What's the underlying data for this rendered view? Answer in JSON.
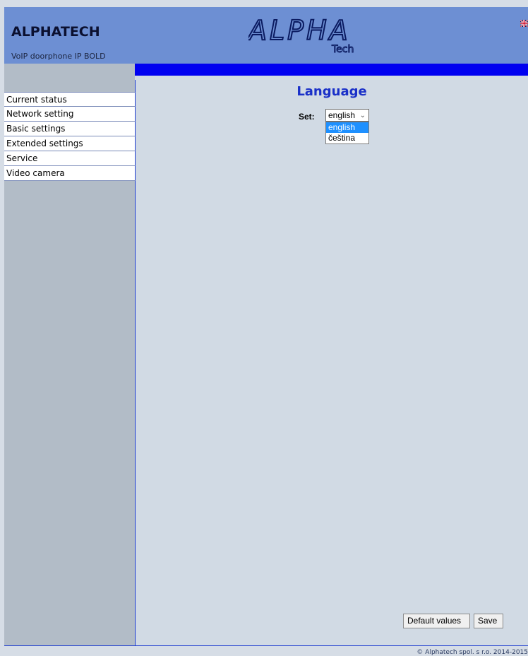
{
  "header": {
    "title": "ALPHATECH",
    "subtitle": "VoIP doorphone IP BOLD",
    "logo_text_main": "ALPHA",
    "logo_text_sub": "Tech",
    "flag_icon": "uk-flag-icon"
  },
  "sidebar": {
    "items": [
      {
        "label": "Current status"
      },
      {
        "label": "Network setting"
      },
      {
        "label": "Basic settings"
      },
      {
        "label": "Extended settings"
      },
      {
        "label": "Service"
      },
      {
        "label": "Video camera"
      }
    ]
  },
  "main": {
    "heading": "Language",
    "set_label": "Set:",
    "language_select": {
      "value": "english",
      "options": [
        "english",
        "čeština"
      ],
      "highlighted": "english"
    }
  },
  "buttons": {
    "default_values": "Default values",
    "save": "Save"
  },
  "footer": {
    "copyright": "© Alphatech spol. s r.o. 2014-2015"
  },
  "colors": {
    "header_bg": "#6d8fd3",
    "accent_blue": "#0000f0",
    "heading_blue": "#1a30c8",
    "sidebar_bg": "#b2bcc7",
    "content_bg": "#d1dae4",
    "select_highlight": "#1e90ff"
  }
}
